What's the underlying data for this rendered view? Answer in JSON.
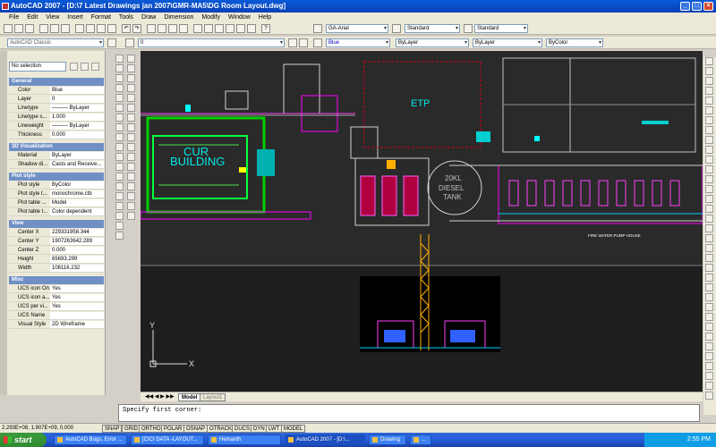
{
  "window": {
    "title": "AutoCAD 2007 - [D:\\7 Latest Drawings jan 2007\\GMR-MA5\\DG Room Layout.dwg]"
  },
  "menu": [
    "File",
    "Edit",
    "View",
    "Insert",
    "Format",
    "Tools",
    "Draw",
    "Dimension",
    "Modify",
    "Window",
    "Help"
  ],
  "toolbars": {
    "workspace": "AutoCAD Classic",
    "layer": "0",
    "textstyle": "GA-Arial",
    "dimstyle": "Standard",
    "tablestyle": "Standard",
    "color": "Blue",
    "linetype": "ByLayer",
    "lineweight": "ByLayer",
    "plotstyle": "ByColor"
  },
  "properties": {
    "selection": "No selection",
    "sections": [
      {
        "title": "General",
        "rows": [
          {
            "k": "Color",
            "v": "Blue"
          },
          {
            "k": "Layer",
            "v": "0"
          },
          {
            "k": "Linetype",
            "v": "——— ByLayer"
          },
          {
            "k": "Linetype s...",
            "v": "1.000"
          },
          {
            "k": "Lineweight",
            "v": "——— ByLayer"
          },
          {
            "k": "Thickness",
            "v": "0.000"
          }
        ]
      },
      {
        "title": "3D Visualization",
        "rows": [
          {
            "k": "Material",
            "v": "ByLayer"
          },
          {
            "k": "Shadow di...",
            "v": "Casts and Receive..."
          }
        ]
      },
      {
        "title": "Plot style",
        "rows": [
          {
            "k": "Plot style",
            "v": "ByColor"
          },
          {
            "k": "Plot style t...",
            "v": "monochrome.ctb"
          },
          {
            "k": "Plot table ...",
            "v": "Model"
          },
          {
            "k": "Plot table t...",
            "v": "Color dependent"
          }
        ]
      },
      {
        "title": "View",
        "rows": [
          {
            "k": "Center X",
            "v": "229331958.344"
          },
          {
            "k": "Center Y",
            "v": "1907263642.289"
          },
          {
            "k": "Center Z",
            "v": "0.000"
          },
          {
            "k": "Height",
            "v": "65693.299"
          },
          {
            "k": "Width",
            "v": "108116.232"
          }
        ]
      },
      {
        "title": "Misc",
        "rows": [
          {
            "k": "UCS icon On",
            "v": "Yes"
          },
          {
            "k": "UCS icon a...",
            "v": "Yes"
          },
          {
            "k": "UCS per vi...",
            "v": "Yes"
          },
          {
            "k": "UCS Name",
            "v": ""
          },
          {
            "k": "Visual Style",
            "v": "2D Wireframe"
          }
        ]
      }
    ]
  },
  "drawing": {
    "labels": {
      "cur": "CUR",
      "building": "BUILDING",
      "etp": "ETP",
      "tank1": "20KL",
      "tank2": "DIESEL",
      "tank3": "TANK",
      "pump": "FIRE WATER PUMP HOUSE"
    },
    "ucs": {
      "x": "X",
      "y": "Y"
    }
  },
  "tabs": [
    "Model",
    "Layout1"
  ],
  "command": "Specify first corner:",
  "status": {
    "coords": "2.293E+08, 1.907E+09, 0.000",
    "buttons": [
      "SNAP",
      "GRID",
      "ORTHO",
      "POLAR",
      "OSNAP",
      "OTRACK",
      "DUCS",
      "DYN",
      "LWT",
      "MODEL"
    ]
  },
  "taskbar": {
    "start": "start",
    "tasks": [
      "AutoCAD Bugs, Error ...",
      "[CICI DATA -LAYOUT...",
      "Hemanth",
      "AutoCAD 2007 - [D:\\...",
      "Drawing",
      "..."
    ],
    "clock": "2:55 PM"
  }
}
